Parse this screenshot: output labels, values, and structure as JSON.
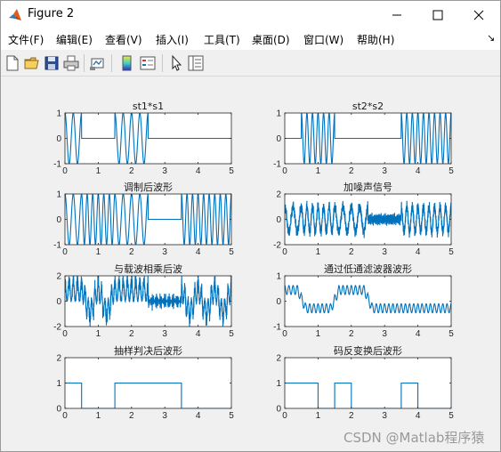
{
  "window": {
    "title": "Figure 2",
    "controls": [
      "minimize",
      "maximize",
      "close"
    ]
  },
  "menu": [
    {
      "label": "文件(F)"
    },
    {
      "label": "编辑(E)"
    },
    {
      "label": "查看(V)"
    },
    {
      "label": "插入(I)"
    },
    {
      "label": "工具(T)"
    },
    {
      "label": "桌面(D)"
    },
    {
      "label": "窗口(W)"
    },
    {
      "label": "帮助(H)"
    }
  ],
  "toolbar": [
    {
      "icon": "new-figure-icon"
    },
    {
      "icon": "open-file-icon"
    },
    {
      "icon": "save-icon"
    },
    {
      "icon": "print-icon"
    },
    {
      "icon": "link-plot-icon"
    },
    {
      "icon": "insert-colorbar-icon"
    },
    {
      "icon": "insert-legend-icon"
    },
    {
      "icon": "pointer-icon"
    },
    {
      "icon": "plot-browser-icon"
    }
  ],
  "chart_data": [
    {
      "type": "line",
      "title": "st1*s1",
      "xlim": [
        0,
        5
      ],
      "ylim": [
        -1,
        1
      ],
      "xticks": [
        0,
        1,
        2,
        3,
        4,
        5
      ],
      "yticks": [
        -1,
        0,
        1
      ],
      "signal": "bursts",
      "bits": [
        1,
        0,
        0,
        1,
        1,
        0,
        0,
        0,
        0,
        0
      ]
    },
    {
      "type": "line",
      "title": "st2*s2",
      "xlim": [
        0,
        5
      ],
      "ylim": [
        -1,
        1
      ],
      "xticks": [
        0,
        1,
        2,
        3,
        4,
        5
      ],
      "yticks": [
        -1,
        0,
        1
      ],
      "signal": "bursts",
      "bits": [
        0,
        1,
        1,
        0,
        0,
        0,
        0,
        1,
        1,
        1
      ]
    },
    {
      "type": "line",
      "title": "调制后波形",
      "xlim": [
        0,
        5
      ],
      "ylim": [
        -1,
        1
      ],
      "xticks": [
        0,
        1,
        2,
        3,
        4,
        5
      ],
      "yticks": [
        -1,
        0,
        1
      ],
      "signal": "fsk"
    },
    {
      "type": "line",
      "title": "加噪声信号",
      "xlim": [
        0,
        5
      ],
      "ylim": [
        -2,
        2
      ],
      "xticks": [
        0,
        1,
        2,
        3,
        4,
        5
      ],
      "yticks": [
        -2,
        0,
        2
      ],
      "signal": "noisy"
    },
    {
      "type": "line",
      "title": "与载波相乘后波",
      "xlim": [
        0,
        5
      ],
      "ylim": [
        -2,
        2
      ],
      "xticks": [
        0,
        1,
        2,
        3,
        4,
        5
      ],
      "yticks": [
        -2,
        0,
        2
      ],
      "signal": "mixed"
    },
    {
      "type": "line",
      "title": "通过低通滤波器波形",
      "xlim": [
        0,
        5
      ],
      "ylim": [
        -1,
        1
      ],
      "xticks": [
        0,
        1,
        2,
        3,
        4,
        5
      ],
      "yticks": [
        -1,
        0,
        1
      ],
      "signal": "filtered"
    },
    {
      "type": "line",
      "title": "抽样判决后波形",
      "xlim": [
        0,
        5
      ],
      "ylim": [
        0,
        2
      ],
      "xticks": [
        0,
        1,
        2,
        3,
        4,
        5
      ],
      "yticks": [
        0,
        1,
        2
      ],
      "signal": "step",
      "x": [
        0,
        0.5,
        0.5,
        1.5,
        1.5,
        3.5,
        3.5,
        5
      ],
      "y": [
        1,
        1,
        0,
        0,
        1,
        1,
        0,
        0
      ]
    },
    {
      "type": "line",
      "title": "码反变换后波形",
      "xlim": [
        0,
        5
      ],
      "ylim": [
        0,
        2
      ],
      "xticks": [
        0,
        1,
        2,
        3,
        4,
        5
      ],
      "yticks": [
        0,
        1,
        2
      ],
      "signal": "step",
      "x": [
        0,
        1,
        1,
        1.5,
        1.5,
        2,
        2,
        3.5,
        3.5,
        4,
        4,
        5
      ],
      "y": [
        1,
        1,
        0,
        0,
        1,
        1,
        0,
        0,
        1,
        1,
        0,
        0
      ]
    }
  ],
  "colors": {
    "line": "#0072bd",
    "axes_bg": "#ffffff",
    "figure_bg": "#f0f0f0"
  },
  "watermark": "CSDN @Matlab程序猿"
}
